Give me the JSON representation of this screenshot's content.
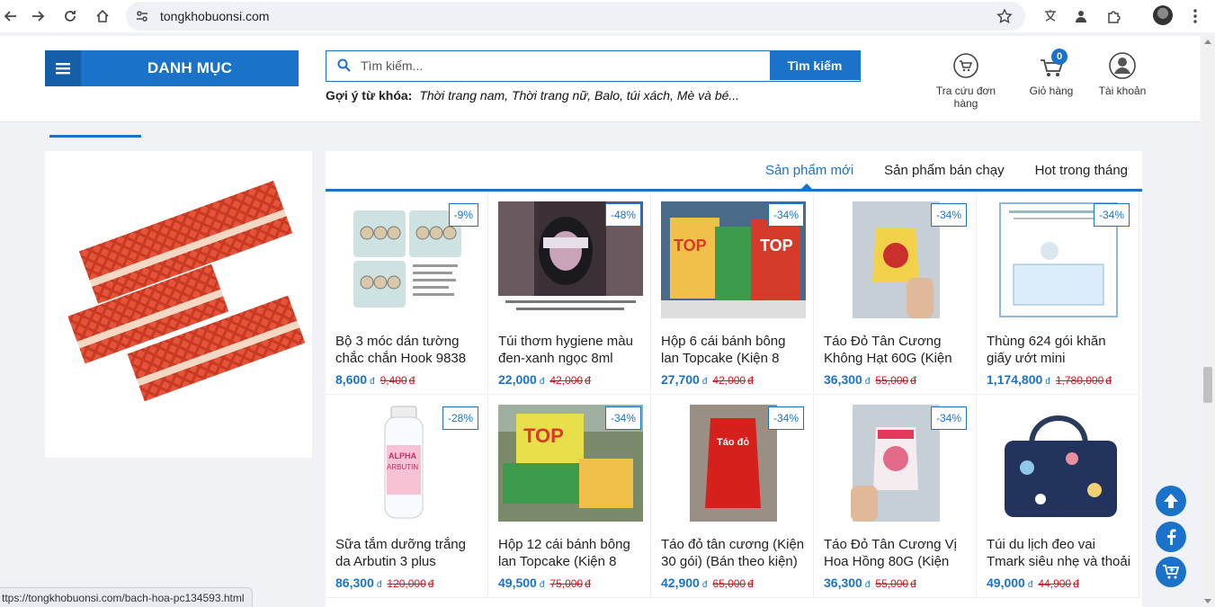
{
  "browser": {
    "url": "tongkhobuonsi.com",
    "status_url": "ttps://tongkhobuonsi.com/bach-hoa-pc134593.html"
  },
  "header": {
    "category_label": "DANH MỤC",
    "search_placeholder": "Tìm kiếm...",
    "search_button": "Tìm kiếm",
    "suggest_label": "Gợi ý từ khóa:",
    "suggest_keywords": "Thời trang nam, Thời trang nữ, Balo, túi xách, Mè và bé...",
    "order_lookup": "Tra cứu đơn hàng",
    "cart": "Giỏ hàng",
    "cart_count": "0",
    "account": "Tài khoản"
  },
  "tabs": [
    "Sản phẩm mới",
    "Sản phẩm bán chạy",
    "Hot trong tháng"
  ],
  "currency": "đ",
  "products": [
    {
      "name": "Bộ 3 móc dán tường chắc chắn Hook 9838",
      "price": "8,600",
      "old_price": "9,400",
      "discount": "-9%"
    },
    {
      "name": "Túi thơm hygiene màu đen-xanh ngọc 8ml",
      "price": "22,000",
      "old_price": "42,000",
      "discount": "-48%"
    },
    {
      "name": "Hộp 6 cái bánh bông lan Topcake (Kiện 8",
      "price": "27,700",
      "old_price": "42,000",
      "discount": "-34%"
    },
    {
      "name": "Táo Đỏ Tân Cương Không Hạt 60G (Kiện",
      "price": "36,300",
      "old_price": "55,000",
      "discount": "-34%"
    },
    {
      "name": "Thùng 624 gói khăn giấy ướt mini",
      "price": "1,174,800",
      "old_price": "1,780,000",
      "discount": "-34%"
    },
    {
      "name": "Sữa tắm dưỡng trắng da Arbutin 3 plus",
      "price": "86,300",
      "old_price": "120,000",
      "discount": "-28%"
    },
    {
      "name": "Hộp 12 cái bánh bông lan Topcake (Kiện 8",
      "price": "49,500",
      "old_price": "75,000",
      "discount": "-34%"
    },
    {
      "name": "Táo đỏ tân cương (Kiện 30 gói) (Bán theo kiện)",
      "price": "42,900",
      "old_price": "65,000",
      "discount": "-34%"
    },
    {
      "name": "Táo Đỏ Tân Cương Vị Hoa Hồng 80G (Kiện",
      "price": "36,300",
      "old_price": "55,000",
      "discount": "-34%"
    },
    {
      "name": "Túi du lịch đeo vai Tmark siêu nhẹ và thoải",
      "price": "49,000",
      "old_price": "44,900",
      "discount": ""
    }
  ],
  "colors": {
    "accent": "#1a73c9",
    "old_price": "#dd1122"
  }
}
